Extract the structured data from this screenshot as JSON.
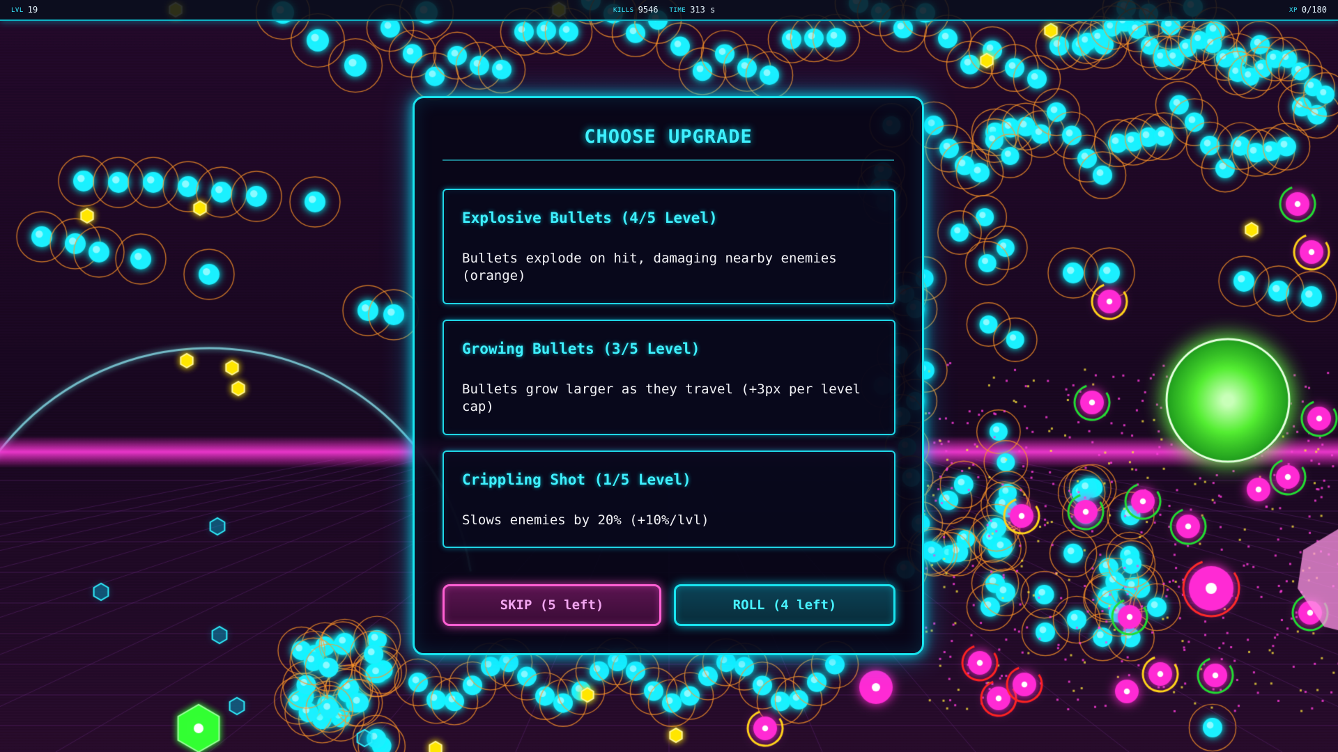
{
  "hud": {
    "level_label": "LVL",
    "level_value": "19",
    "kills_label": "KILLS",
    "kills_value": "9546",
    "time_label": "TIME",
    "time_value": "313 s",
    "xp_label": "XP",
    "xp_value": "0/180"
  },
  "modal": {
    "title": "CHOOSE UPGRADE",
    "options": [
      {
        "title": "Explosive Bullets (4/5 Level)",
        "description": "Bullets explode on hit, damaging nearby enemies (orange)"
      },
      {
        "title": "Growing Bullets (3/5 Level)",
        "description": "Bullets grow larger as they travel (+3px per level cap)"
      },
      {
        "title": "Crippling Shot (1/5 Level)",
        "description": "Slows enemies by 20% (+10%/lvl)"
      }
    ],
    "skip_label": "SKIP (5 left)",
    "roll_label": "ROLL (4 left)"
  },
  "colors": {
    "accent_cyan": "#19e3ee",
    "accent_magenta": "#ff5fd2",
    "enemy_magenta": "#ff2ad4",
    "pickup_yellow": "#ffe600",
    "boss_green": "#66ff44",
    "background": "#1a0820"
  }
}
